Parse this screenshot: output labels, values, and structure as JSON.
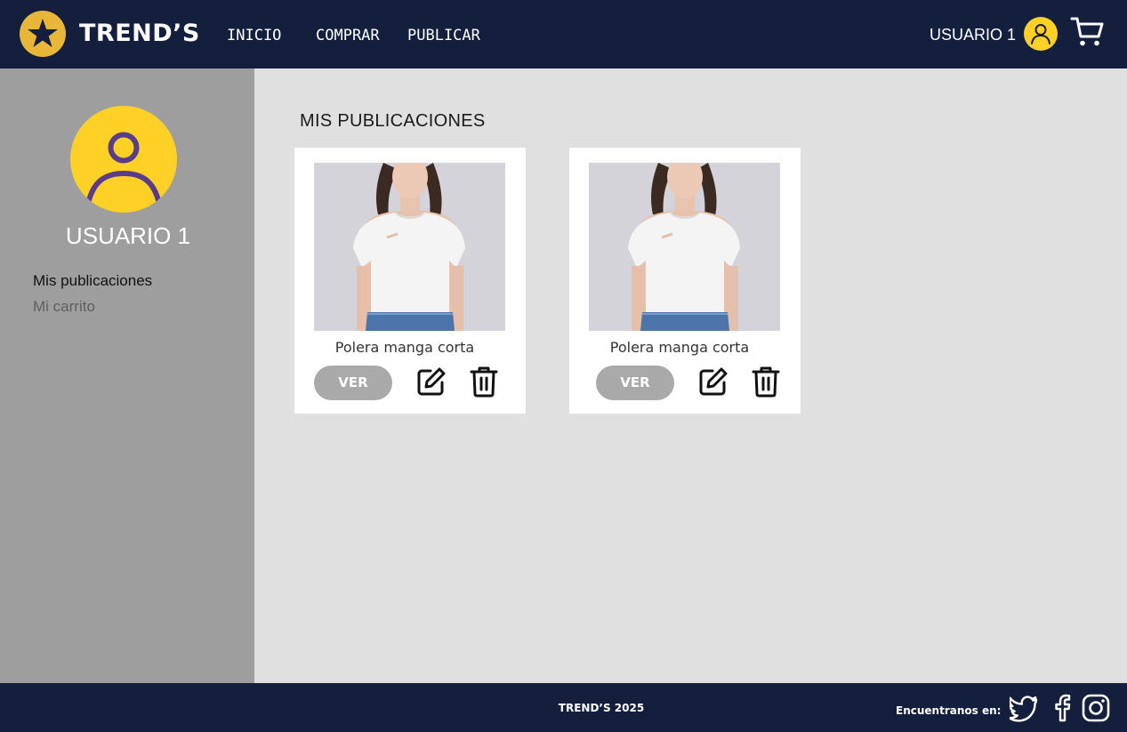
{
  "header": {
    "brand": "TREND’S",
    "nav": [
      {
        "label": "INICIO"
      },
      {
        "label": "COMPRAR"
      },
      {
        "label": "PUBLICAR"
      }
    ],
    "user_name": "USUARIO 1",
    "logo_icon": "star-icon",
    "avatar_icon": "user-icon",
    "cart_icon": "cart-icon"
  },
  "sidebar": {
    "profile_name": "USUARIO 1",
    "items": [
      {
        "label": "Mis publicaciones",
        "active": true
      },
      {
        "label": "Mi carrito",
        "active": false
      }
    ]
  },
  "main": {
    "title": "MIS PUBLICACIONES",
    "cards": [
      {
        "title": "Polera manga corta",
        "view_label": "VER",
        "image": "woman-white-tshirt-photo"
      },
      {
        "title": "Polera manga corta",
        "view_label": "VER",
        "image": "woman-white-tshirt-photo"
      }
    ]
  },
  "footer": {
    "copyright": "TREND’S 2025",
    "find_us": "Encuentranos en:",
    "social": [
      "twitter-icon",
      "facebook-icon",
      "instagram-icon"
    ]
  },
  "colors": {
    "header_bg": "#141f3d",
    "accent_yellow": "#ffd026",
    "logo_gold": "#e8b73a",
    "sidebar_bg": "#9e9e9e",
    "main_bg": "#e0e0e0",
    "button_gray": "#a9a9a9",
    "avatar_purple": "#5b3b8c"
  }
}
